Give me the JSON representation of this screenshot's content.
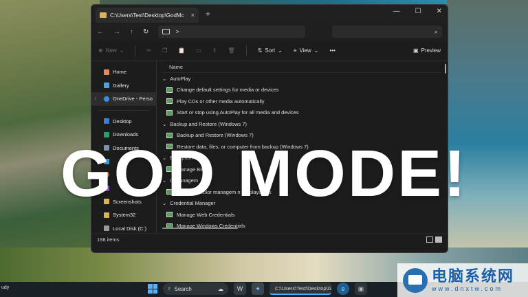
{
  "window": {
    "tab_title": "C:\\Users\\Test\\Desktop\\GodMc",
    "tab_close": "×",
    "new_tab": "+",
    "controls": {
      "minimize": "—",
      "maximize": "☐",
      "close": "✕"
    }
  },
  "address": {
    "back": "←",
    "forward": "→",
    "up": "↑",
    "refresh": "↻",
    "path_chevron": ">",
    "search_icon": "⌕"
  },
  "toolbar": {
    "new_label": "New",
    "sort_label": "Sort",
    "view_label": "View",
    "more_label": "•••",
    "preview_label": "Preview"
  },
  "nav": {
    "items": [
      {
        "label": "Home",
        "icon": "home-icon",
        "color": "#e88a5a"
      },
      {
        "label": "Gallery",
        "icon": "gallery-icon",
        "color": "#4aa3e0"
      },
      {
        "label": "OneDrive - Perso",
        "icon": "cloud-icon",
        "color": "#3a8ee6"
      }
    ],
    "quick": [
      {
        "label": "Desktop",
        "icon": "desktop-icon",
        "color": "#3a7fd0"
      },
      {
        "label": "Downloads",
        "icon": "download-icon",
        "color": "#2f9a6a"
      },
      {
        "label": "Documents",
        "icon": "document-icon",
        "color": "#7a8fa8"
      },
      {
        "label": "",
        "icon": "pictures-icon",
        "color": "#3ba0d8"
      },
      {
        "label": "",
        "icon": "music-icon",
        "color": "#d25a3a"
      },
      {
        "label": "",
        "icon": "videos-icon",
        "color": "#8a5ad0"
      },
      {
        "label": "Screenshots",
        "icon": "folder-icon",
        "color": "#d9b45a"
      },
      {
        "label": "System32",
        "icon": "folder-icon",
        "color": "#d9b45a"
      },
      {
        "label": "Local Disk (C:)",
        "icon": "disk-icon",
        "color": "#9a9a9a"
      }
    ]
  },
  "content": {
    "column_name": "Name",
    "groups": [
      {
        "title": "AutoPlay",
        "rows": [
          "Change default settings for media or devices",
          "Play CDs or other media automatically",
          "Start or stop using AutoPlay for all media and devices"
        ]
      },
      {
        "title": "Backup and Restore (Windows 7)",
        "rows": [
          "Backup and Restore (Windows 7)",
          "Restore data, files, or computer from backup (Windows 7)"
        ]
      },
      {
        "title": "B                    cryption",
        "rows": [
          "Manage BitL"
        ]
      },
      {
        "title": "C    Managem",
        "rows": [
          "Change        d color managem       n for     plays,       ,        rs"
        ]
      },
      {
        "title": "Credential Manager",
        "rows": [
          "Manage Web Credentials",
          "Manage Windows Credentials"
        ]
      }
    ]
  },
  "status": {
    "items_count": "198 items"
  },
  "overlay": {
    "headline": "GOD MODE!"
  },
  "taskbar": {
    "left_text": "udy",
    "search_label": "Search",
    "explorer_label": "C:\\Users\\Test\\Desktop\\G"
  },
  "watermark": {
    "title": "电脑系统网",
    "url": "www.dnxtw.com"
  }
}
